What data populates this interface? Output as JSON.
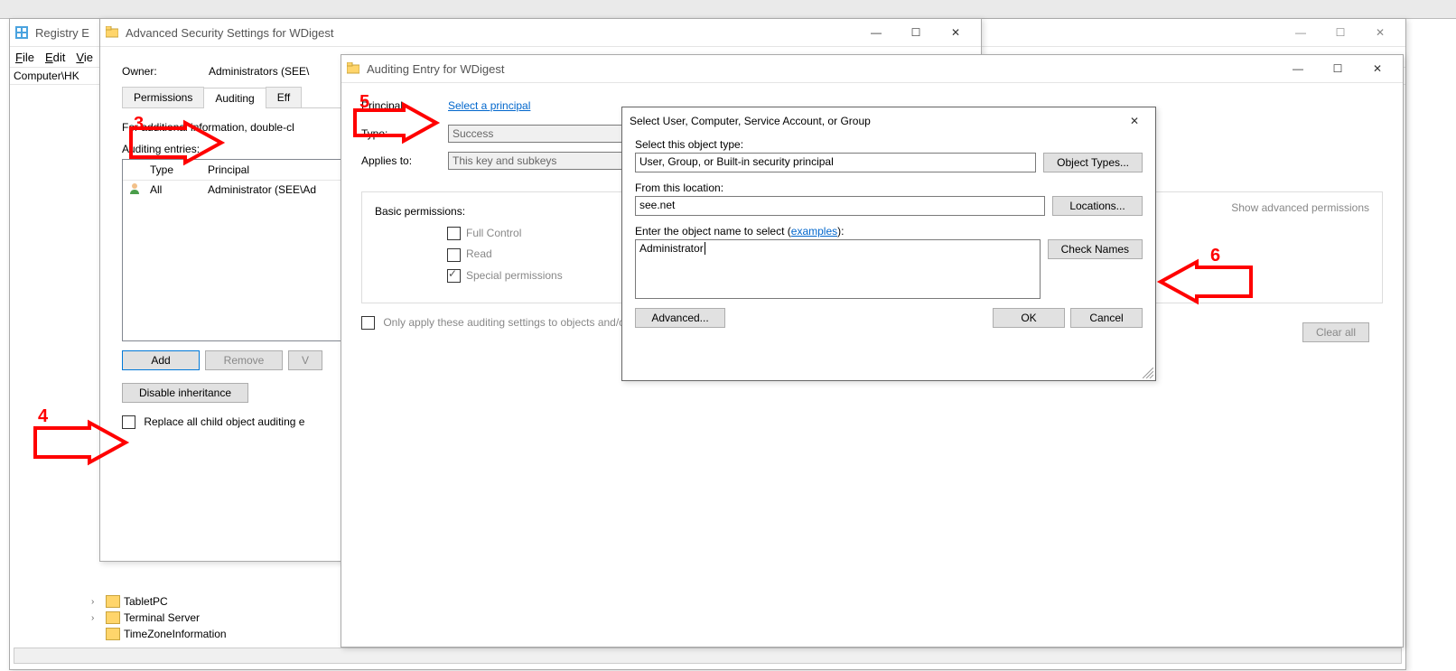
{
  "regedit": {
    "title": "Registry E",
    "menu": {
      "file": "File",
      "edit": "Edit",
      "view": "Vie"
    },
    "path": "Computer\\HK",
    "tree": {
      "tabletpc": "TabletPC",
      "terminal": "Terminal Server",
      "timezone": "TimeZoneInformation"
    }
  },
  "advsec": {
    "title": "Advanced Security Settings for WDigest",
    "owner_lbl": "Owner:",
    "owner_val": "Administrators (SEE\\",
    "tabs": {
      "perm": "Permissions",
      "audit": "Auditing",
      "eff": "Eff"
    },
    "info": "For additional information, double-cl",
    "entries_lbl": "Auditing entries:",
    "headers": {
      "type": "Type",
      "principal": "Principal"
    },
    "row": {
      "type": "All",
      "principal": "Administrator (SEE\\Ad"
    },
    "buttons": {
      "add": "Add",
      "remove": "Remove",
      "view": "V",
      "disable": "Disable inheritance"
    },
    "replace": "Replace all child object auditing e"
  },
  "audentry": {
    "title": "Auditing Entry for WDigest",
    "principal_lbl": "Principal:",
    "principal_link": "Select a principal",
    "type_lbl": "Type:",
    "type_val": "Success",
    "applies_lbl": "Applies to:",
    "applies_val": "This key and subkeys",
    "basic": "Basic permissions:",
    "perm_full": "Full Control",
    "perm_read": "Read",
    "perm_special": "Special permissions",
    "showadv": "Show advanced permissions",
    "onlyapply": "Only apply these auditing settings to objects and/or containers within this container",
    "clearall": "Clear all"
  },
  "seldlg": {
    "title": "Select User, Computer, Service Account, or Group",
    "objtype_lbl": "Select this object type:",
    "objtype_val": "User, Group, or Built-in security principal",
    "objtype_btn": "Object Types...",
    "loc_lbl": "From this location:",
    "loc_val": "see.net",
    "loc_btn": "Locations...",
    "name_lbl": "Enter the object name to select (",
    "name_link": "examples",
    "name_lbl_end": "):",
    "name_val": "Administrator",
    "check_btn": "Check Names",
    "adv_btn": "Advanced...",
    "ok": "OK",
    "cancel": "Cancel"
  },
  "annotations": {
    "n3": "3",
    "n4": "4",
    "n5": "5",
    "n6": "6"
  }
}
